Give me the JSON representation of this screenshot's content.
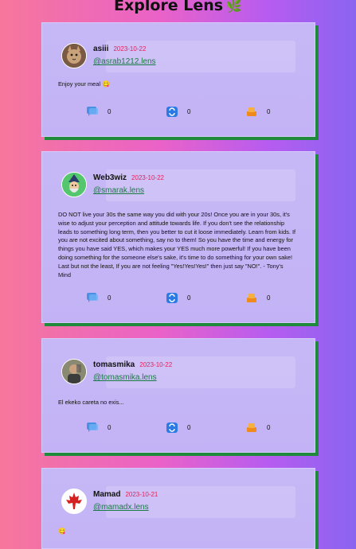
{
  "page": {
    "title": "Explore Lens",
    "title_icon": "🌿"
  },
  "posts": [
    {
      "username": "asiii",
      "date": "2023-10-22",
      "handle": "@asrab1212.lens",
      "avatar": "cat-avatar",
      "content": "Enjoy your meal",
      "content_emoji": "😋",
      "comments": "0",
      "mirrors": "0",
      "collects": "0"
    },
    {
      "username": "Web3wiz",
      "date": "2023-10-22",
      "handle": "@smarak.lens",
      "avatar": "wizard-avatar",
      "content": "DO NOT live your 30s the same way you did with your 20s! Once you are in your 30s, it's wise to adjust your perception and attitude towards life. If you don't see the relationship leads to something long term, then you better to cut it loose immediately. Learn from kids. If you are not excited about something, say no to them! So you have the time and energy for things you have said YES, which makes your YES much more powerful! If you have been doing something for the someone else's sake, it's time to do something for your own sake! Last but not the least, If you are not feeling \"Yes!Yes!Yes!\" then just say \"NO!\". - Tony's Mind",
      "content_emoji": "",
      "comments": "0",
      "mirrors": "0",
      "collects": "0"
    },
    {
      "username": "tomasmika",
      "date": "2023-10-22",
      "handle": "@tomasmika.lens",
      "avatar": "person-avatar",
      "content": "El ekeko careta no exis...",
      "content_emoji": "",
      "comments": "0",
      "mirrors": "0",
      "collects": "0"
    },
    {
      "username": "Mamad",
      "date": "2023-10-21",
      "handle": "@mamadx.lens",
      "avatar": "maple-leaf-avatar",
      "content": "",
      "content_emoji": "😋",
      "comments": "",
      "mirrors": "",
      "collects": ""
    }
  ],
  "colors": {
    "date": "#e0245e",
    "handle": "#1a7a44",
    "shadow": "#1f8a3b"
  }
}
